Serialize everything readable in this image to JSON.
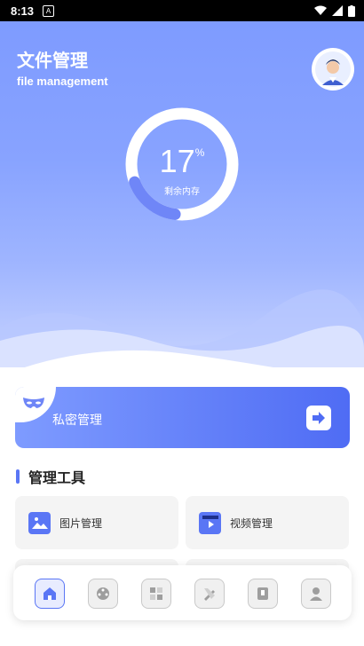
{
  "status_bar": {
    "time": "8:13",
    "notif_icon": "A"
  },
  "header": {
    "title": "文件管理",
    "subtitle": "file management"
  },
  "storage": {
    "value": "17",
    "unit": "%",
    "label": "剩余内存",
    "progress": 0.17
  },
  "private_card": {
    "label": "私密管理"
  },
  "section": {
    "title": "管理工具"
  },
  "tools": [
    {
      "label": "图片管理",
      "icon": "image-icon"
    },
    {
      "label": "视频管理",
      "icon": "video-icon"
    }
  ],
  "nav": [
    "home-icon",
    "film-reel-icon",
    "grid-icon",
    "tools-icon",
    "document-icon",
    "user-icon"
  ],
  "colors": {
    "accent": "#5a76f5",
    "header_top": "#7e9bff",
    "card_end": "#4f6cf4"
  }
}
